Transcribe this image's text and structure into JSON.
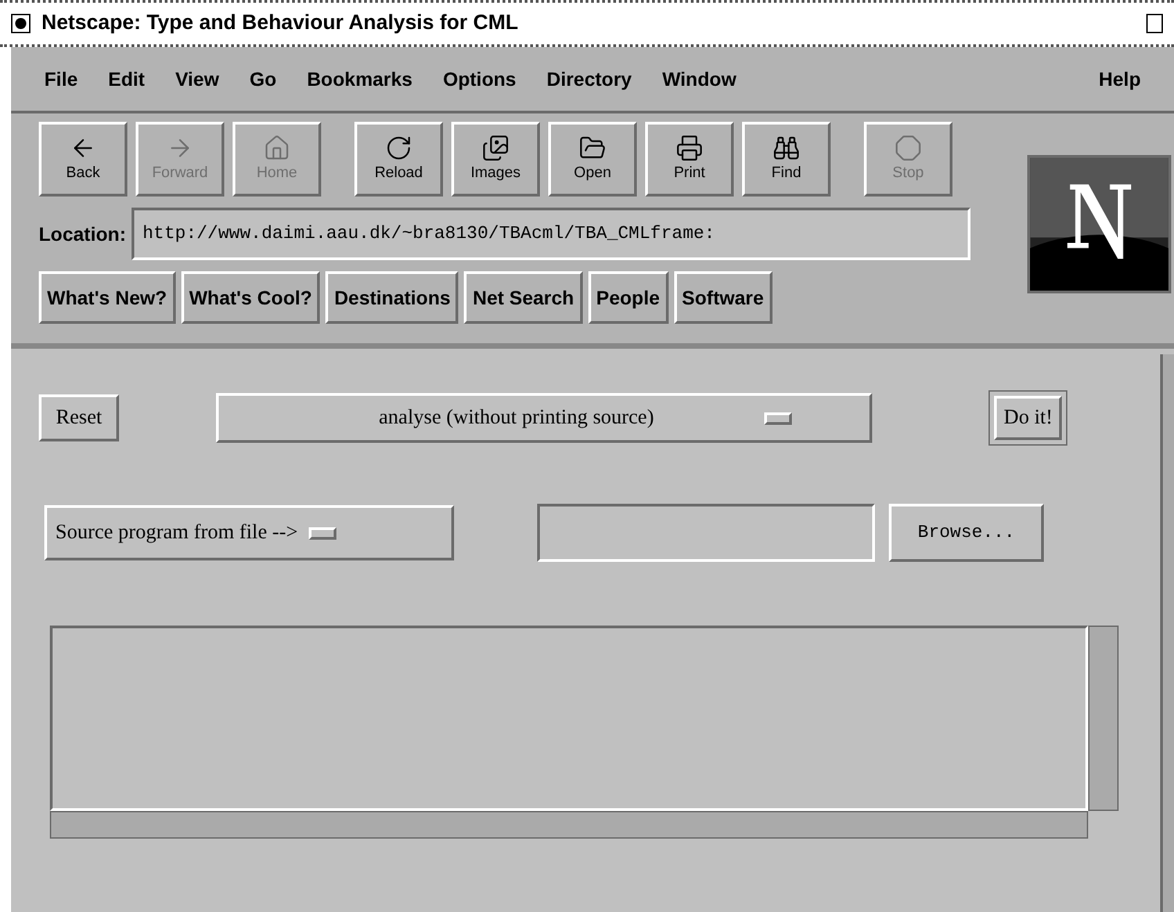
{
  "window": {
    "title": "Netscape: Type and Behaviour Analysis for CML"
  },
  "menu": [
    "File",
    "Edit",
    "View",
    "Go",
    "Bookmarks",
    "Options",
    "Directory",
    "Window"
  ],
  "help_menu": "Help",
  "toolbar": [
    {
      "label": "Back",
      "disabled": false
    },
    {
      "label": "Forward",
      "disabled": true
    },
    {
      "label": "Home",
      "disabled": true
    },
    {
      "label": "Reload",
      "disabled": false
    },
    {
      "label": "Images",
      "disabled": false
    },
    {
      "label": "Open",
      "disabled": false
    },
    {
      "label": "Print",
      "disabled": false
    },
    {
      "label": "Find",
      "disabled": false
    },
    {
      "label": "Stop",
      "disabled": true
    }
  ],
  "location": {
    "label": "Location:",
    "value": "http://www.daimi.aau.dk/~bra8130/TBAcml/TBA_CMLframe:"
  },
  "directory_buttons": [
    "What's New?",
    "What's Cool?",
    "Destinations",
    "Net Search",
    "People",
    "Software"
  ],
  "form": {
    "reset": "Reset",
    "mode_select": "analyse (without printing source)",
    "submit": {
      "label": "Do it!",
      "default": true
    },
    "source_select": "Source program from file -->",
    "browse": "Browse..."
  }
}
